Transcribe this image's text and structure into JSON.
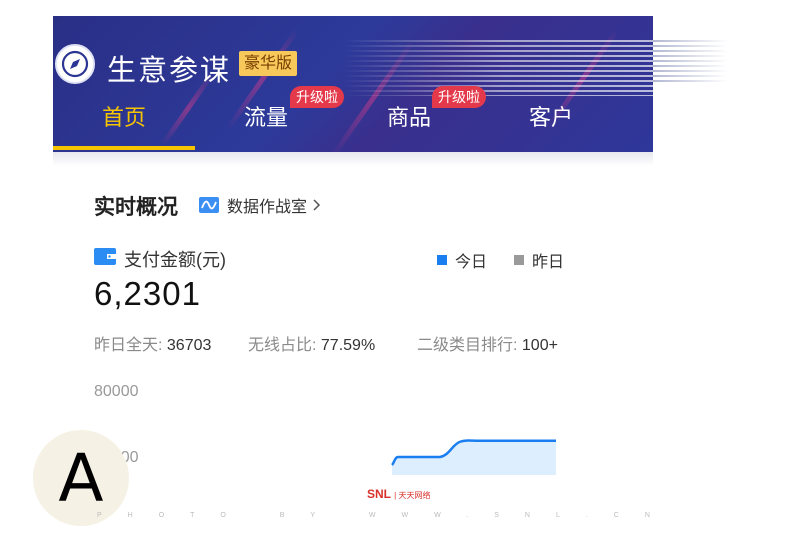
{
  "header": {
    "app_title": "生意参谋",
    "edition_badge": "豪华版",
    "tabs": [
      {
        "label": "首页",
        "active": true
      },
      {
        "label": "流量",
        "badge": "升级啦"
      },
      {
        "label": "商品",
        "badge": "升级啦"
      },
      {
        "label": "客户"
      }
    ],
    "colors": {
      "background": "#2b3594",
      "active_tab": "#f7c400",
      "badge": "#e4394b"
    }
  },
  "overview": {
    "title": "实时概况",
    "war_room_link": "数据作战室",
    "metric_label": "支付金额(元)",
    "legend": [
      {
        "label": "今日",
        "color": "#1a7ef0"
      },
      {
        "label": "昨日",
        "color": "#9a9a9a"
      }
    ],
    "value": "6,2301",
    "stats": [
      {
        "key": "昨日全天:",
        "value": "36703"
      },
      {
        "key": "无线占比:",
        "value": "77.59%"
      },
      {
        "key": "二级类目排行:",
        "value": "100+"
      }
    ]
  },
  "chart_data": {
    "type": "area",
    "series": [
      {
        "name": "今日",
        "values": [
          0,
          40000,
          40000,
          50000,
          50000,
          50000,
          50000
        ]
      }
    ],
    "y_ticks": [
      "80000",
      "40000"
    ],
    "ylim": [
      0,
      80000
    ],
    "color": "#1a7ef0"
  },
  "overlay": {
    "letter": "A",
    "watermark_logo": "SNL",
    "watermark_logo_cn": "天天网络",
    "watermark_text": "PHOTO BY WWW.SNL.CN"
  }
}
